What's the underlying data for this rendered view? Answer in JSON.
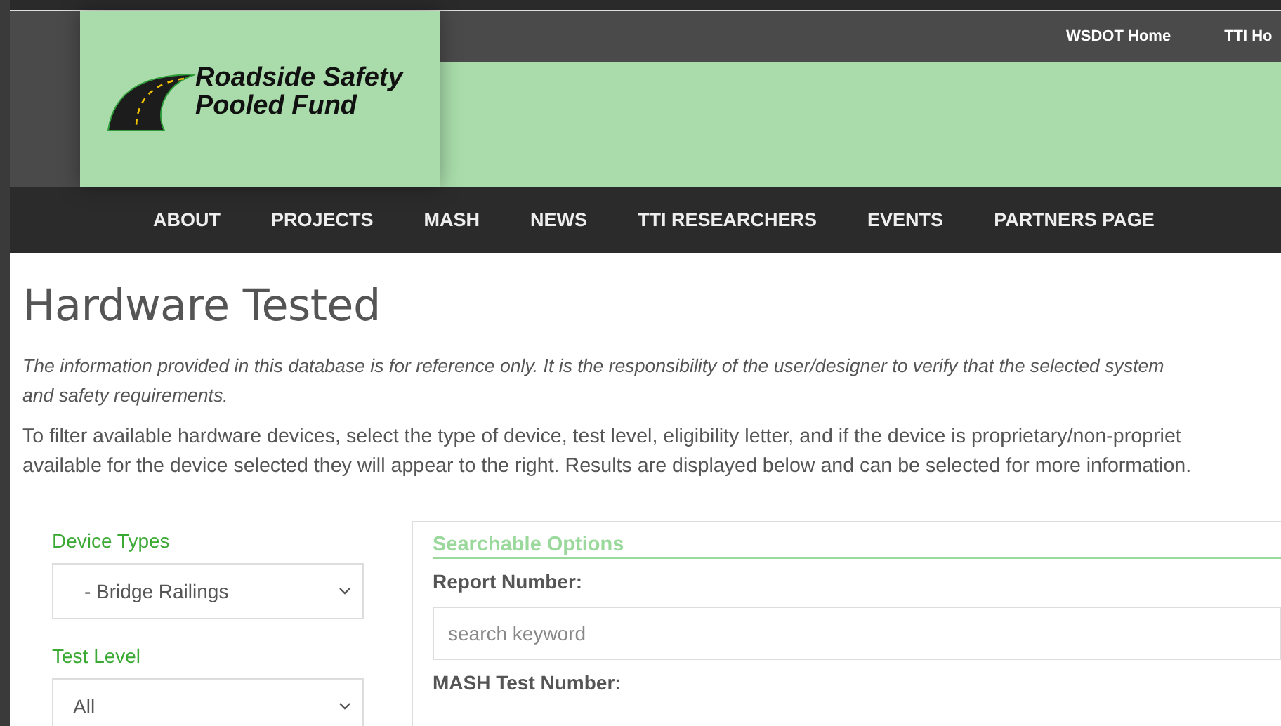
{
  "top_links": [
    "WSDOT Home",
    "TTI Ho"
  ],
  "logo": {
    "lines": [
      "Roadside Safety",
      "Pooled Fund"
    ]
  },
  "nav": [
    {
      "label": "ABOUT"
    },
    {
      "label": "PROJECTS"
    },
    {
      "label": "MASH"
    },
    {
      "label": "NEWS"
    },
    {
      "label": "TTI RESEARCHERS"
    },
    {
      "label": "EVENTS"
    },
    {
      "label": "PARTNERS PAGE"
    }
  ],
  "page_title": "Hardware Tested",
  "disclaimer": [
    "The information provided in this database is for reference only. It is the responsibility of the user/designer to verify that the selected system",
    "and safety requirements."
  ],
  "instructions": [
    "To filter available hardware devices, select the type of device, test level, eligibility letter, and if the device is proprietary/non-propriet",
    "available for the device selected they will appear to the right. Results are displayed below and can be selected for more information."
  ],
  "filters": [
    {
      "label": "Device Types",
      "value": "- Bridge Railings"
    },
    {
      "label": "Test Level",
      "value": "All"
    }
  ],
  "options": {
    "title": "Searchable Options",
    "fields": [
      {
        "label": "Report Number:",
        "placeholder": "search keyword"
      },
      {
        "label": "MASH Test Number:"
      }
    ]
  }
}
